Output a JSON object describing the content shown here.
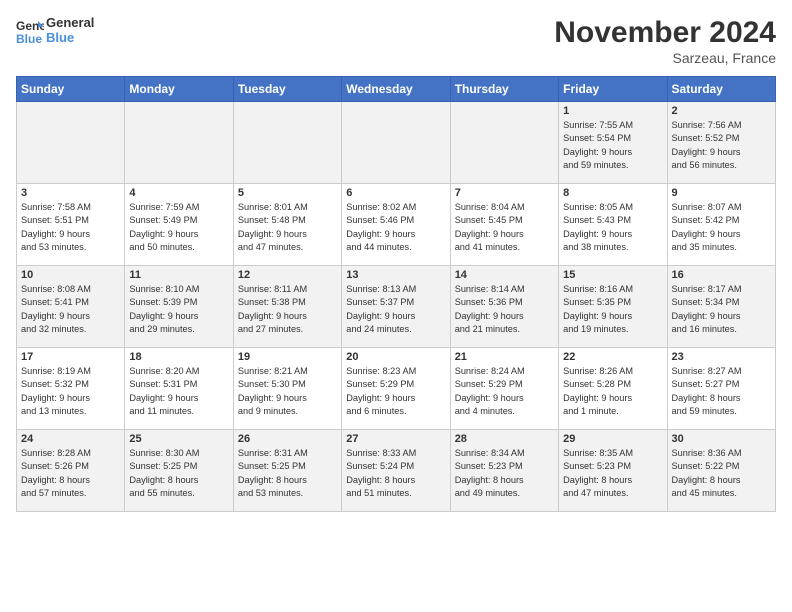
{
  "logo": {
    "line1": "General",
    "line2": "Blue"
  },
  "title": "November 2024",
  "subtitle": "Sarzeau, France",
  "days_of_week": [
    "Sunday",
    "Monday",
    "Tuesday",
    "Wednesday",
    "Thursday",
    "Friday",
    "Saturday"
  ],
  "weeks": [
    [
      {
        "day": "",
        "info": ""
      },
      {
        "day": "",
        "info": ""
      },
      {
        "day": "",
        "info": ""
      },
      {
        "day": "",
        "info": ""
      },
      {
        "day": "",
        "info": ""
      },
      {
        "day": "1",
        "info": "Sunrise: 7:55 AM\nSunset: 5:54 PM\nDaylight: 9 hours\nand 59 minutes."
      },
      {
        "day": "2",
        "info": "Sunrise: 7:56 AM\nSunset: 5:52 PM\nDaylight: 9 hours\nand 56 minutes."
      }
    ],
    [
      {
        "day": "3",
        "info": "Sunrise: 7:58 AM\nSunset: 5:51 PM\nDaylight: 9 hours\nand 53 minutes."
      },
      {
        "day": "4",
        "info": "Sunrise: 7:59 AM\nSunset: 5:49 PM\nDaylight: 9 hours\nand 50 minutes."
      },
      {
        "day": "5",
        "info": "Sunrise: 8:01 AM\nSunset: 5:48 PM\nDaylight: 9 hours\nand 47 minutes."
      },
      {
        "day": "6",
        "info": "Sunrise: 8:02 AM\nSunset: 5:46 PM\nDaylight: 9 hours\nand 44 minutes."
      },
      {
        "day": "7",
        "info": "Sunrise: 8:04 AM\nSunset: 5:45 PM\nDaylight: 9 hours\nand 41 minutes."
      },
      {
        "day": "8",
        "info": "Sunrise: 8:05 AM\nSunset: 5:43 PM\nDaylight: 9 hours\nand 38 minutes."
      },
      {
        "day": "9",
        "info": "Sunrise: 8:07 AM\nSunset: 5:42 PM\nDaylight: 9 hours\nand 35 minutes."
      }
    ],
    [
      {
        "day": "10",
        "info": "Sunrise: 8:08 AM\nSunset: 5:41 PM\nDaylight: 9 hours\nand 32 minutes."
      },
      {
        "day": "11",
        "info": "Sunrise: 8:10 AM\nSunset: 5:39 PM\nDaylight: 9 hours\nand 29 minutes."
      },
      {
        "day": "12",
        "info": "Sunrise: 8:11 AM\nSunset: 5:38 PM\nDaylight: 9 hours\nand 27 minutes."
      },
      {
        "day": "13",
        "info": "Sunrise: 8:13 AM\nSunset: 5:37 PM\nDaylight: 9 hours\nand 24 minutes."
      },
      {
        "day": "14",
        "info": "Sunrise: 8:14 AM\nSunset: 5:36 PM\nDaylight: 9 hours\nand 21 minutes."
      },
      {
        "day": "15",
        "info": "Sunrise: 8:16 AM\nSunset: 5:35 PM\nDaylight: 9 hours\nand 19 minutes."
      },
      {
        "day": "16",
        "info": "Sunrise: 8:17 AM\nSunset: 5:34 PM\nDaylight: 9 hours\nand 16 minutes."
      }
    ],
    [
      {
        "day": "17",
        "info": "Sunrise: 8:19 AM\nSunset: 5:32 PM\nDaylight: 9 hours\nand 13 minutes."
      },
      {
        "day": "18",
        "info": "Sunrise: 8:20 AM\nSunset: 5:31 PM\nDaylight: 9 hours\nand 11 minutes."
      },
      {
        "day": "19",
        "info": "Sunrise: 8:21 AM\nSunset: 5:30 PM\nDaylight: 9 hours\nand 9 minutes."
      },
      {
        "day": "20",
        "info": "Sunrise: 8:23 AM\nSunset: 5:29 PM\nDaylight: 9 hours\nand 6 minutes."
      },
      {
        "day": "21",
        "info": "Sunrise: 8:24 AM\nSunset: 5:29 PM\nDaylight: 9 hours\nand 4 minutes."
      },
      {
        "day": "22",
        "info": "Sunrise: 8:26 AM\nSunset: 5:28 PM\nDaylight: 9 hours\nand 1 minute."
      },
      {
        "day": "23",
        "info": "Sunrise: 8:27 AM\nSunset: 5:27 PM\nDaylight: 8 hours\nand 59 minutes."
      }
    ],
    [
      {
        "day": "24",
        "info": "Sunrise: 8:28 AM\nSunset: 5:26 PM\nDaylight: 8 hours\nand 57 minutes."
      },
      {
        "day": "25",
        "info": "Sunrise: 8:30 AM\nSunset: 5:25 PM\nDaylight: 8 hours\nand 55 minutes."
      },
      {
        "day": "26",
        "info": "Sunrise: 8:31 AM\nSunset: 5:25 PM\nDaylight: 8 hours\nand 53 minutes."
      },
      {
        "day": "27",
        "info": "Sunrise: 8:33 AM\nSunset: 5:24 PM\nDaylight: 8 hours\nand 51 minutes."
      },
      {
        "day": "28",
        "info": "Sunrise: 8:34 AM\nSunset: 5:23 PM\nDaylight: 8 hours\nand 49 minutes."
      },
      {
        "day": "29",
        "info": "Sunrise: 8:35 AM\nSunset: 5:23 PM\nDaylight: 8 hours\nand 47 minutes."
      },
      {
        "day": "30",
        "info": "Sunrise: 8:36 AM\nSunset: 5:22 PM\nDaylight: 8 hours\nand 45 minutes."
      }
    ]
  ]
}
